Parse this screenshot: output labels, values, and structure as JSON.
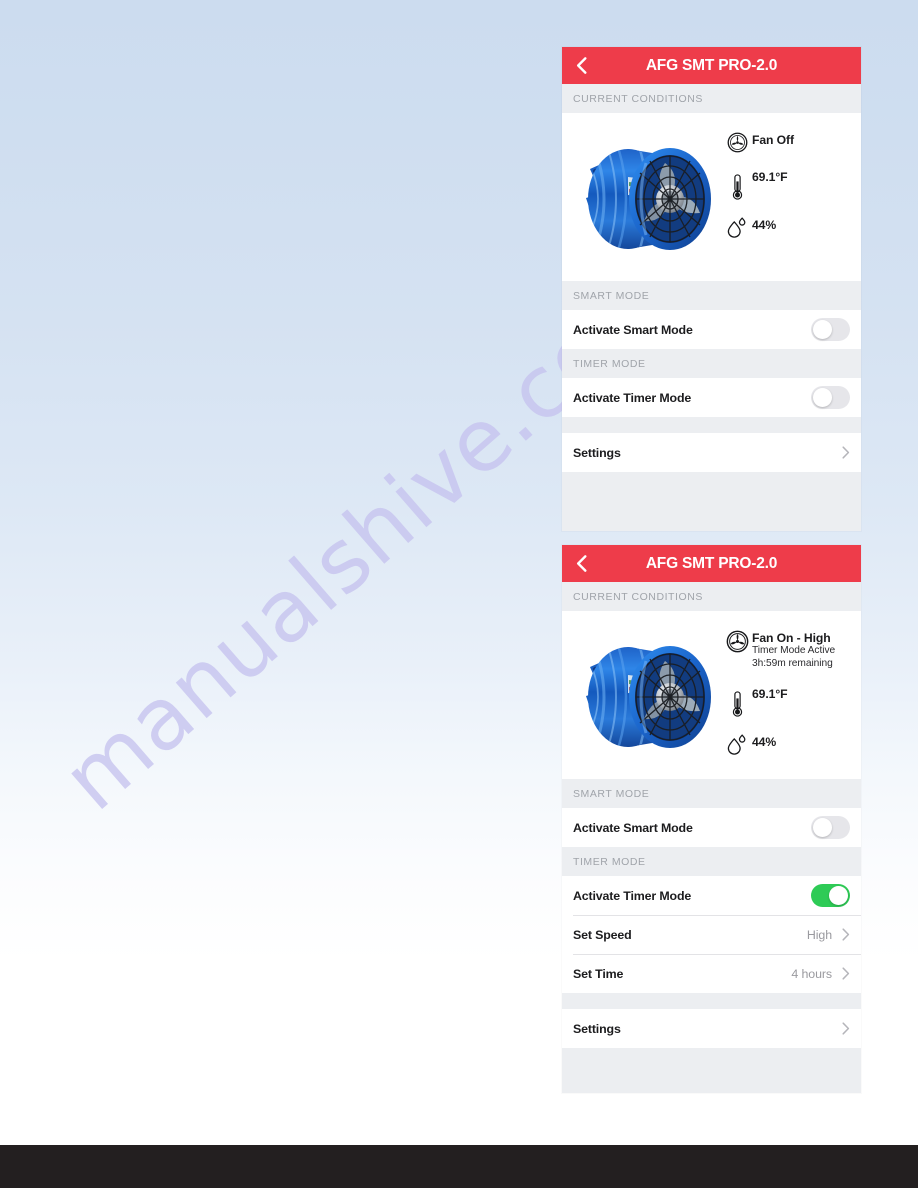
{
  "background": {
    "gradient_top": "#ccdcef",
    "gradient_bottom": "#ffffff",
    "footer_color": "#231f20"
  },
  "watermark": {
    "text": "manualshive.com",
    "color": "#c6c3ef"
  },
  "theme": {
    "accent_red": "#ee3c4a",
    "toggle_on_green": "#2ecb56",
    "toggle_off_gray": "#e6e6ea",
    "section_header_gray": "#a0a4aa",
    "panel_bg": "#eceef1",
    "card_bg": "#ffffff"
  },
  "panels": [
    {
      "id": "panel-fan-off",
      "navbar": {
        "title": "AFG SMT PRO-2.0",
        "back_icon": "chevron-left-icon"
      },
      "sections": {
        "current_conditions": {
          "header": "CURRENT CONDITIONS",
          "product_image_alt": "blue-exhaust-fan",
          "stats": [
            {
              "icon": "fan-icon",
              "main": "Fan Off",
              "sub1": "",
              "sub2": ""
            },
            {
              "icon": "thermometer-icon",
              "value": "69.1°F"
            },
            {
              "icon": "humidity-droplet-icon",
              "value": "44%"
            }
          ]
        },
        "smart_mode": {
          "header": "SMART MODE",
          "rows": [
            {
              "label": "Activate Smart Mode",
              "control": "toggle",
              "state": "off"
            }
          ]
        },
        "timer_mode": {
          "header": "TIMER MODE",
          "rows": [
            {
              "label": "Activate Timer Mode",
              "control": "toggle",
              "state": "off"
            }
          ]
        },
        "settings": {
          "rows": [
            {
              "label": "Settings",
              "control": "chevron",
              "value": ""
            }
          ]
        }
      }
    },
    {
      "id": "panel-fan-on-timer",
      "navbar": {
        "title": "AFG SMT PRO-2.0",
        "back_icon": "chevron-left-icon"
      },
      "sections": {
        "current_conditions": {
          "header": "CURRENT CONDITIONS",
          "product_image_alt": "blue-exhaust-fan",
          "stats": [
            {
              "icon": "fan-icon",
              "main": "Fan On - High",
              "sub1": "Timer Mode Active",
              "sub2": "3h:59m remaining"
            },
            {
              "icon": "thermometer-icon",
              "value": "69.1°F"
            },
            {
              "icon": "humidity-droplet-icon",
              "value": "44%"
            }
          ]
        },
        "smart_mode": {
          "header": "SMART MODE",
          "rows": [
            {
              "label": "Activate Smart Mode",
              "control": "toggle",
              "state": "off"
            }
          ]
        },
        "timer_mode": {
          "header": "TIMER MODE",
          "rows": [
            {
              "label": "Activate Timer Mode",
              "control": "toggle",
              "state": "on"
            },
            {
              "label": "Set Speed",
              "control": "chevron",
              "value": "High"
            },
            {
              "label": "Set Time",
              "control": "chevron",
              "value": "4 hours"
            }
          ]
        },
        "settings": {
          "rows": [
            {
              "label": "Settings",
              "control": "chevron",
              "value": ""
            }
          ]
        }
      }
    }
  ]
}
